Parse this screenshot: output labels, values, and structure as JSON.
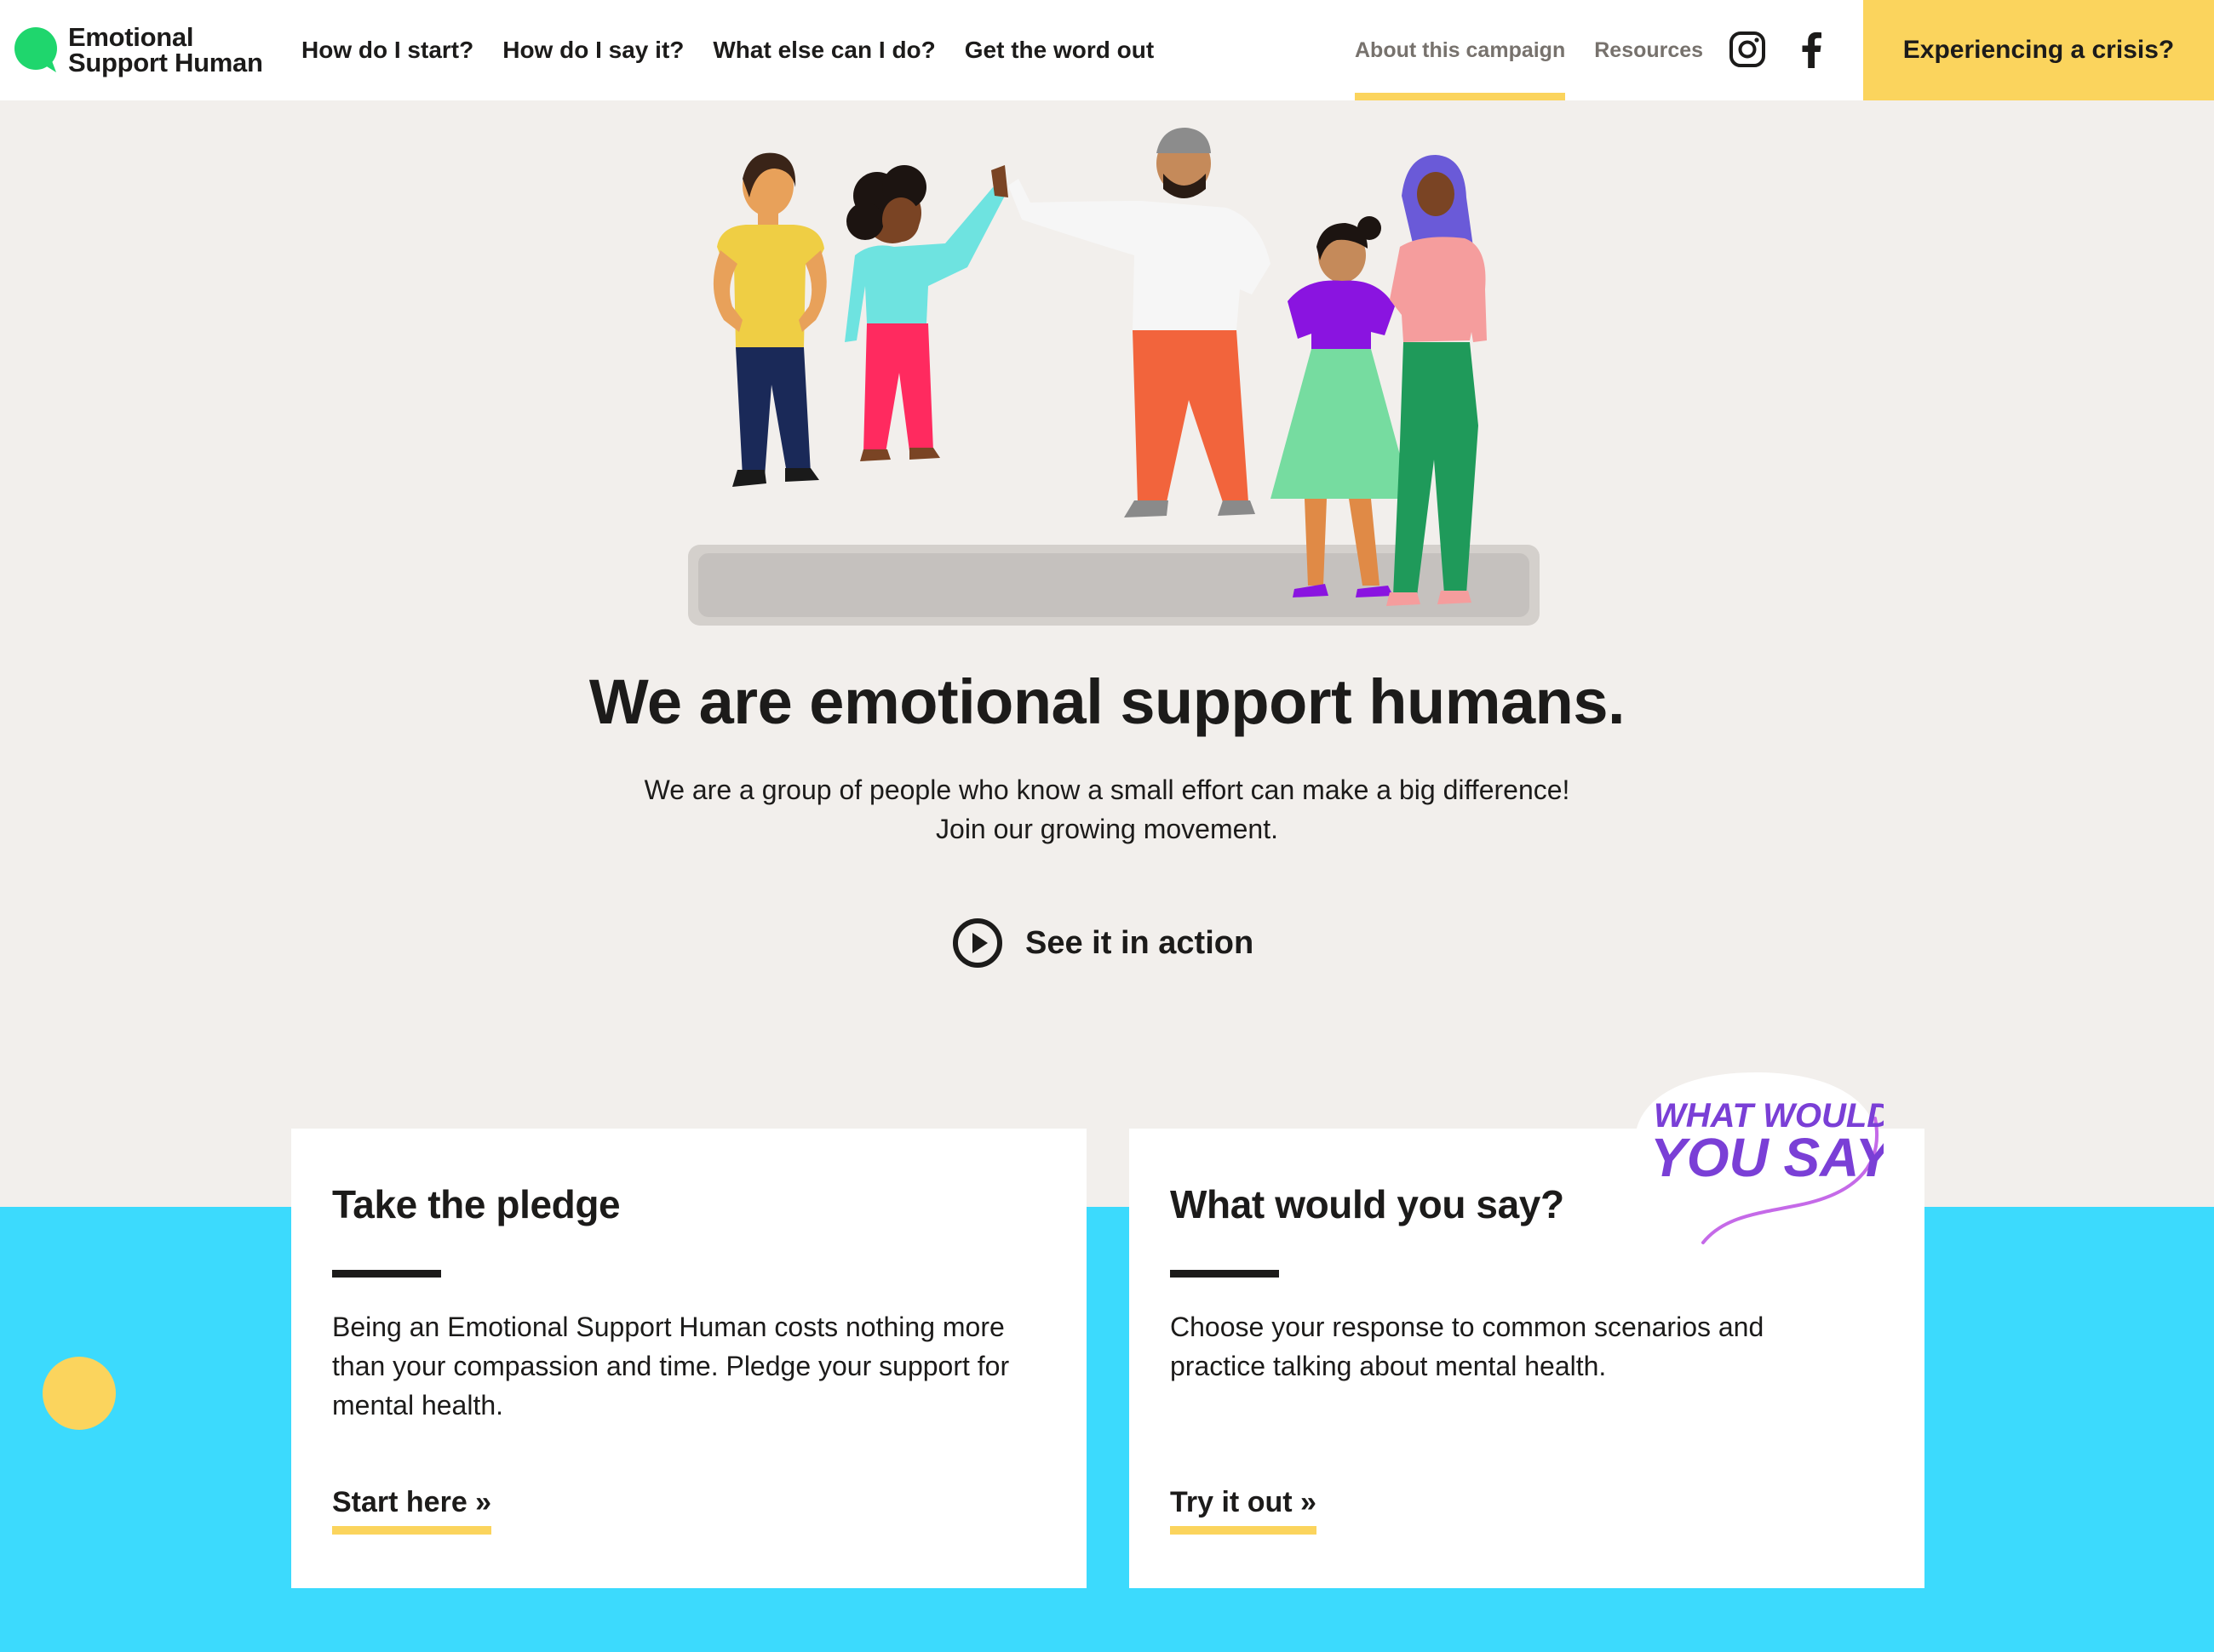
{
  "brand": {
    "line1": "Emotional",
    "line2": "Support Human",
    "logo_color": "#1fd66d"
  },
  "nav": {
    "main": [
      "How do I start?",
      "How do I say it?",
      "What else can I do?",
      "Get the word out"
    ],
    "secondary": [
      {
        "label": "About this campaign",
        "active": true
      },
      {
        "label": "Resources",
        "active": false
      }
    ],
    "social": [
      "instagram-icon",
      "facebook-icon"
    ],
    "crisis_label": "Experiencing a crisis?"
  },
  "hero": {
    "title": "We are emotional support humans.",
    "subtitle_line1": "We are a group of people who know a small effort can make a big difference!",
    "subtitle_line2": "Join our growing movement.",
    "action_label": "See it in action",
    "action_icon": "play-circle-icon"
  },
  "cards": [
    {
      "title": "Take the pledge",
      "body": "Being an Emotional Support Human costs nothing more than your compassion and time. Pledge your support for mental health.",
      "cta": "Start here »"
    },
    {
      "title": "What would you say?",
      "body": "Choose your response to common scenarios and practice talking about mental health.",
      "cta": "Try it out »",
      "badge_line1": "WHAT WOULD",
      "badge_line2": "YOU SAY?"
    }
  ],
  "colors": {
    "accent_yellow": "#fbd45d",
    "band_cyan": "#3cdafd",
    "page_bg": "#f2efec",
    "badge_purple": "#7a3fd6"
  }
}
